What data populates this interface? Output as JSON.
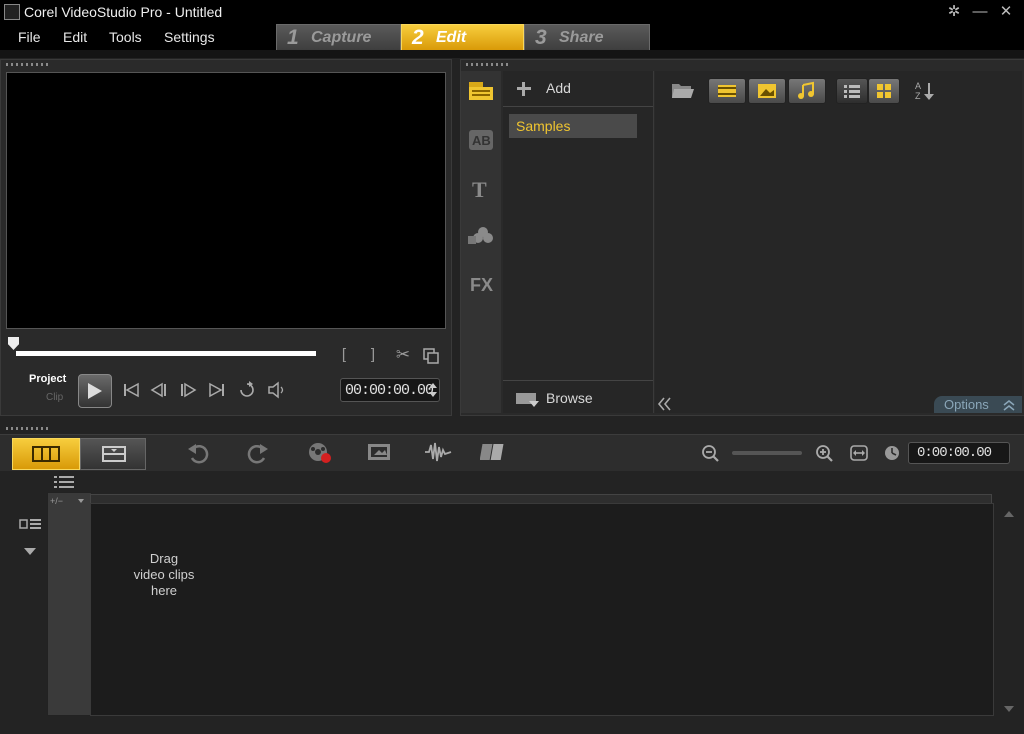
{
  "window": {
    "title": "Corel VideoStudio Pro - Untitled",
    "controls": [
      "settings-icon",
      "minimize-icon",
      "close-icon"
    ]
  },
  "menu": {
    "items": [
      "File",
      "Edit",
      "Tools",
      "Settings"
    ]
  },
  "steps": [
    {
      "num": "1",
      "label": "Capture"
    },
    {
      "num": "2",
      "label": "Edit"
    },
    {
      "num": "3",
      "label": "Share"
    }
  ],
  "player": {
    "mode_project": "Project",
    "mode_clip": "Clip",
    "timecode": "00:00:00.00"
  },
  "library": {
    "add_label": "Add",
    "folders": [
      "Samples"
    ],
    "browse_label": "Browse",
    "options_label": "Options"
  },
  "timeline": {
    "timecode": "0:00:00.00",
    "drag_hint": [
      "Drag",
      "video clips",
      "here"
    ]
  },
  "colors": {
    "accent": "#f0c530",
    "background": "#232323"
  }
}
